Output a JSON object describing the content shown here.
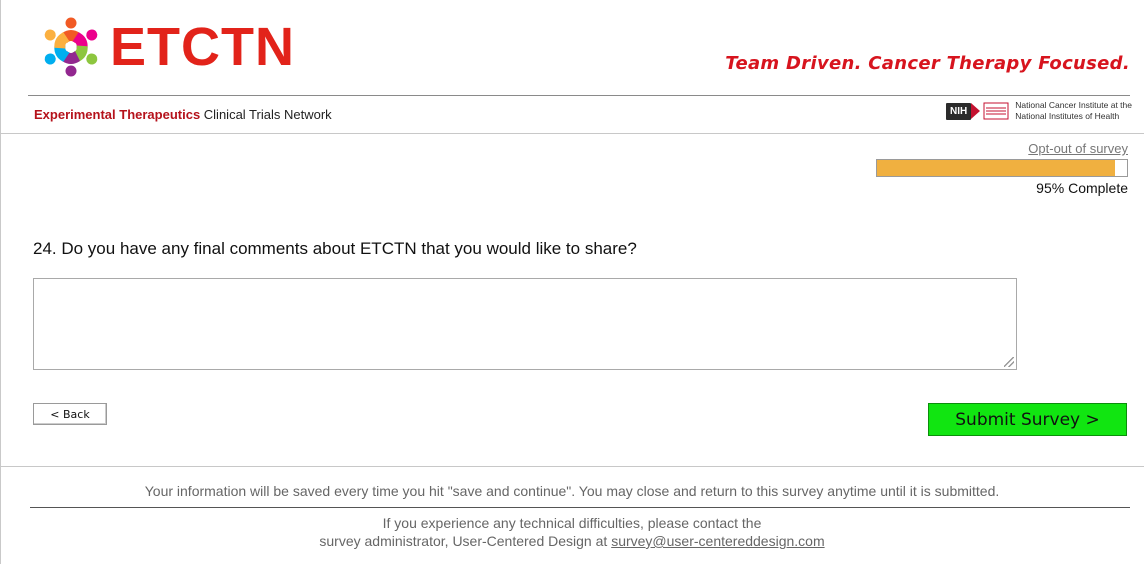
{
  "header": {
    "logo_text": "ETCTN",
    "tagline": "Team Driven. Cancer Therapy Focused.",
    "network_bold": "Experimental Therapeutics",
    "network_rest": " Clinical Trials Network",
    "nih_badge": "NIH",
    "nci_line1": "National Cancer Institute at the",
    "nci_line2": "National Institutes of Health"
  },
  "progress": {
    "optout_label": "Opt-out of survey",
    "percent": 95,
    "label": "95% Complete",
    "fill_color": "#f0b040"
  },
  "question": {
    "text": "24. Do you have any final comments about ETCTN that you would like to share?",
    "answer_value": ""
  },
  "buttons": {
    "back_label": "< Back",
    "submit_label": "Submit Survey >",
    "submit_color": "#11e511"
  },
  "footer": {
    "save_note": "Your information will be saved every time you hit \"save and continue\". You may close and return to this survey anytime until it is submitted.",
    "contact_line1": "If you experience any technical difficulties, please contact the",
    "contact_line2_prefix": "survey administrator, User-Centered Design at ",
    "contact_email": "survey@user-centereddesign.com"
  },
  "icons": {
    "logo_figure": "people-ring-icon",
    "nih_arrow": "nih-arrow-icon",
    "nci_emblem": "nci-emblem-icon"
  },
  "colors": {
    "brand_red": "#e2231a",
    "tagline_red": "#d7141e"
  }
}
